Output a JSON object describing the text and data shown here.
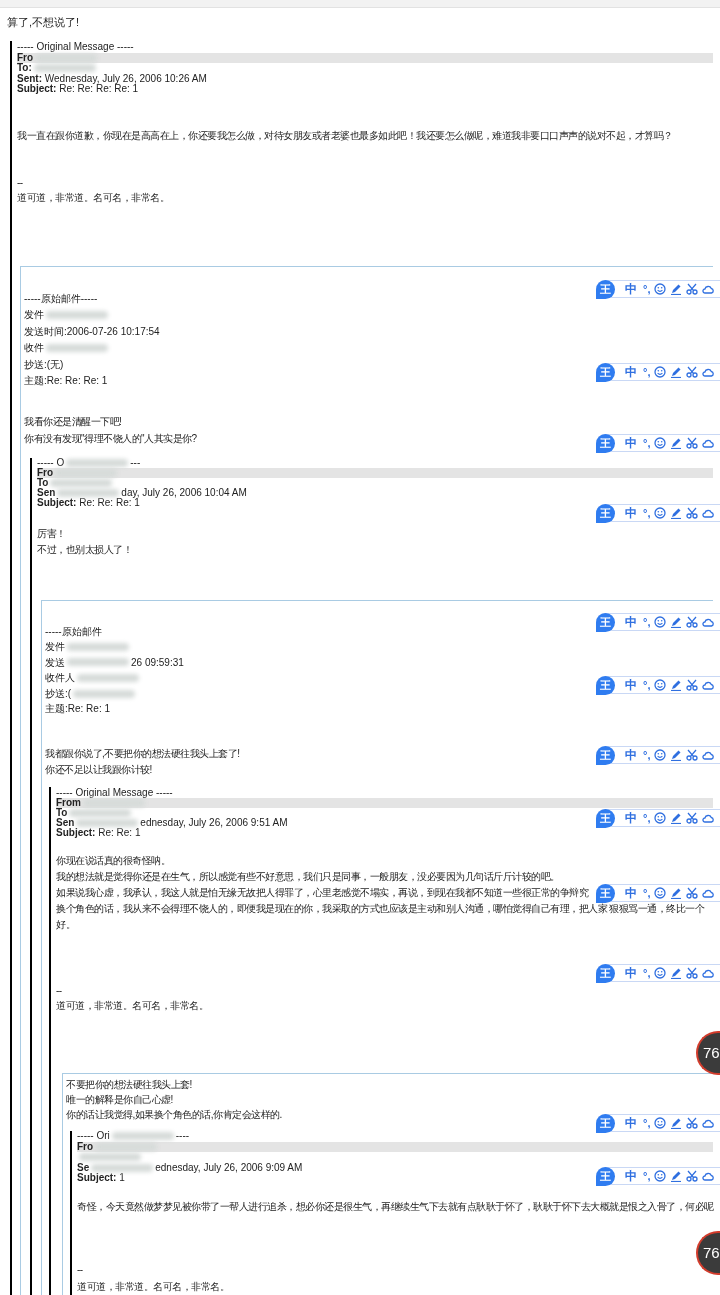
{
  "reply": "算了,不想说了!",
  "thread": {
    "kind": "outlook",
    "header": [
      {
        "text": "----- Original Message -----"
      },
      {
        "text": "**Fro**",
        "shaded": true,
        "redacted": true
      },
      {
        "text": "**To:**",
        "redacted": true
      },
      {
        "text": "**Sent:** Wednesday, July 26, 2006 10:26 AM"
      },
      {
        "text": "**Subject:** Re: Re: Re: Re: 1"
      }
    ],
    "paragraphs": [
      [
        "我一直在跟你道歉，你现在是高高在上，你还要我怎么做，对待女朋友或者老婆也最多如此吧！我还要怎么做呢，难道我非要口口声声的说对不起，才算吗？"
      ],
      [
        "--",
        "道可道，非常道。名可名，非常名。"
      ]
    ],
    "child": {
      "kind": "quote",
      "header": [
        {
          "text": "-----原始邮件-----"
        },
        {
          "text": "发件",
          "redacted": true
        },
        {
          "text": "发送时间:2006-07-26 10:17:54"
        },
        {
          "text": "收件",
          "redacted": true
        },
        {
          "text": "抄送:(无)"
        },
        {
          "text": "主题:Re: Re: Re: 1"
        }
      ],
      "paragraphs": [
        [
          "我看你还是清醒一下吧!",
          "你有没有发现\"得理不饶人的\"人其实是你?"
        ]
      ],
      "child": {
        "kind": "outlook",
        "header": [
          {
            "text": "----- O",
            "redacted": true,
            "after": "---"
          },
          {
            "text": "**Fro**",
            "shaded": true,
            "redacted": true
          },
          {
            "text": "**To**",
            "redacted": true
          },
          {
            "text": "**Sen**",
            "redacted": true,
            "after": "day, July 26, 2006 10:04 AM"
          },
          {
            "text": "**Subject:** Re: Re: Re: 1"
          }
        ],
        "paragraphs": [
          [
            "厉害！",
            "不过，也别太损人了！"
          ]
        ],
        "child": {
          "kind": "quote",
          "header": [
            {
              "text": "-----原始邮件"
            },
            {
              "text": "发件",
              "redacted": true
            },
            {
              "text": "发送",
              "redacted": true,
              "after": "26 09:59:31"
            },
            {
              "text": "收件人",
              "redacted": true
            },
            {
              "text": "抄送:(",
              "redacted": true
            },
            {
              "text": "主题:Re: Re: 1"
            }
          ],
          "paragraphs": [
            [
              "我都跟你说了,不要把你的想法硬往我头上套了!",
              "你还不足以让我跟你计较!"
            ]
          ],
          "child": {
            "kind": "outlook",
            "header": [
              {
                "text": "----- Original Message -----"
              },
              {
                "text": "**From**",
                "shaded": true,
                "redacted": true
              },
              {
                "text": "**To**",
                "redacted": true
              },
              {
                "text": "**Sen**",
                "redacted": true,
                "after": "ednesday, July 26, 2006 9:51 AM"
              },
              {
                "text": "**Subject:** Re: Re: 1"
              }
            ],
            "paragraphs": [
              [
                "你现在说话真的很奇怪呐。",
                "我的想法就是觉得你还是在生气，所以感觉有些不好意思，我们只是同事，一般朋友，没必要因为几句话斤斤计较的吧。",
                "如果说我心虚，我承认，我这人就是怕无缘无故把人得罪了，心里老感觉不塌实，再说，到现在我都不知道一些很正常的争辩究",
                "换个角色的话，我从来不会得理不饶人的，即便我是现在的你，我采取的方式也应该是主动和别人沟通，哪怕觉得自己有理，把人家 狠狠骂一通，终比一个",
                "好。"
              ],
              [
                "--",
                "道可道，非常道。名可名，非常名。"
              ]
            ],
            "child": {
              "kind": "quote",
              "paragraphs": [
                [
                  "不要把你的想法硬往我头上套!",
                  "唯一的解释是你自己心虚!",
                  "你的话让我觉得,如果换个角色的话,你肯定会这样的."
                ]
              ],
              "child": {
                "kind": "outlook",
                "header": [
                  {
                    "text": "----- Ori",
                    "redacted": true,
                    "after": "----"
                  },
                  {
                    "text": "**Fro**",
                    "shaded": true,
                    "redacted": true
                  },
                  {
                    "redacted": true
                  },
                  {
                    "text": "**Se**",
                    "redacted": true,
                    "after": "ednesday, July 26, 2006 9:09 AM"
                  },
                  {
                    "text": "**Subject:** 1"
                  }
                ],
                "paragraphs": [
                  [
                    "奇怪，今天竟然做梦梦见被你带了一帮人进行追杀，想必你还是很生气，再继续生气下去就有点耿耿于怀了，耿耿于怀下去大概就是恨之入骨了，何必呢"
                  ],
                  [
                    "--",
                    "道可道，非常道。名可名，非常名。"
                  ]
                ]
              }
            }
          }
        }
      }
    }
  },
  "ime_toolbars": [
    {
      "logo": "王",
      "mode": "中",
      "punct": "°,"
    },
    {
      "logo": "王",
      "mode": "中",
      "punct": "°,"
    },
    {
      "logo": "王",
      "mode": "中",
      "punct": "°,"
    },
    {
      "logo": "王",
      "mode": "中",
      "punct": "°,"
    },
    {
      "logo": "王",
      "mode": "中",
      "punct": "°,"
    },
    {
      "logo": "王",
      "mode": "中",
      "punct": "°,"
    },
    {
      "logo": "王",
      "mode": "中",
      "punct": "°,"
    },
    {
      "logo": "王",
      "mode": "中",
      "punct": "°,"
    },
    {
      "logo": "王",
      "mode": "中",
      "punct": "°,"
    },
    {
      "logo": "王",
      "mode": "中",
      "punct": "°,"
    },
    {
      "logo": "王",
      "mode": "中",
      "punct": "°,"
    },
    {
      "logo": "王",
      "mode": "中",
      "punct": "°,"
    }
  ],
  "badges": [
    {
      "text": "76"
    },
    {
      "text": "76"
    }
  ]
}
